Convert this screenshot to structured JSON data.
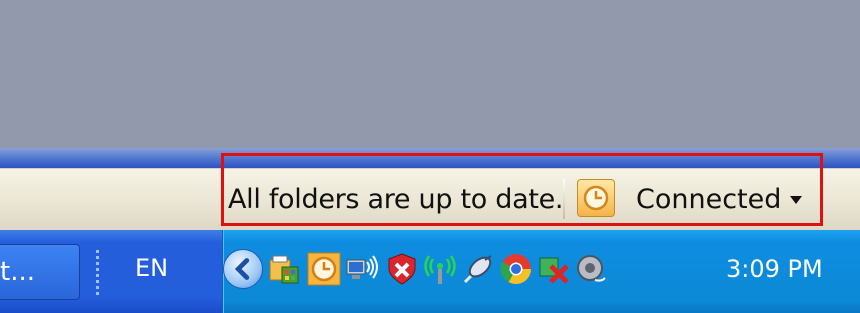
{
  "status_bar": {
    "message": "All folders are up to date.",
    "connection_label": "Connected"
  },
  "taskbar": {
    "task_button_label": "t...",
    "language": "EN",
    "clock": "3:09 PM"
  },
  "tray_icons": [
    "chevron-left-icon",
    "outlook-calendar-icon",
    "clock-icon",
    "network-icon",
    "security-shield-icon",
    "wireless-icon",
    "satellite-icon",
    "chrome-icon",
    "cross-out-icon",
    "speaker-icon"
  ],
  "colors": {
    "highlight": "#e01010",
    "taskbar": "#245edb",
    "tray": "#0c8ad6"
  }
}
